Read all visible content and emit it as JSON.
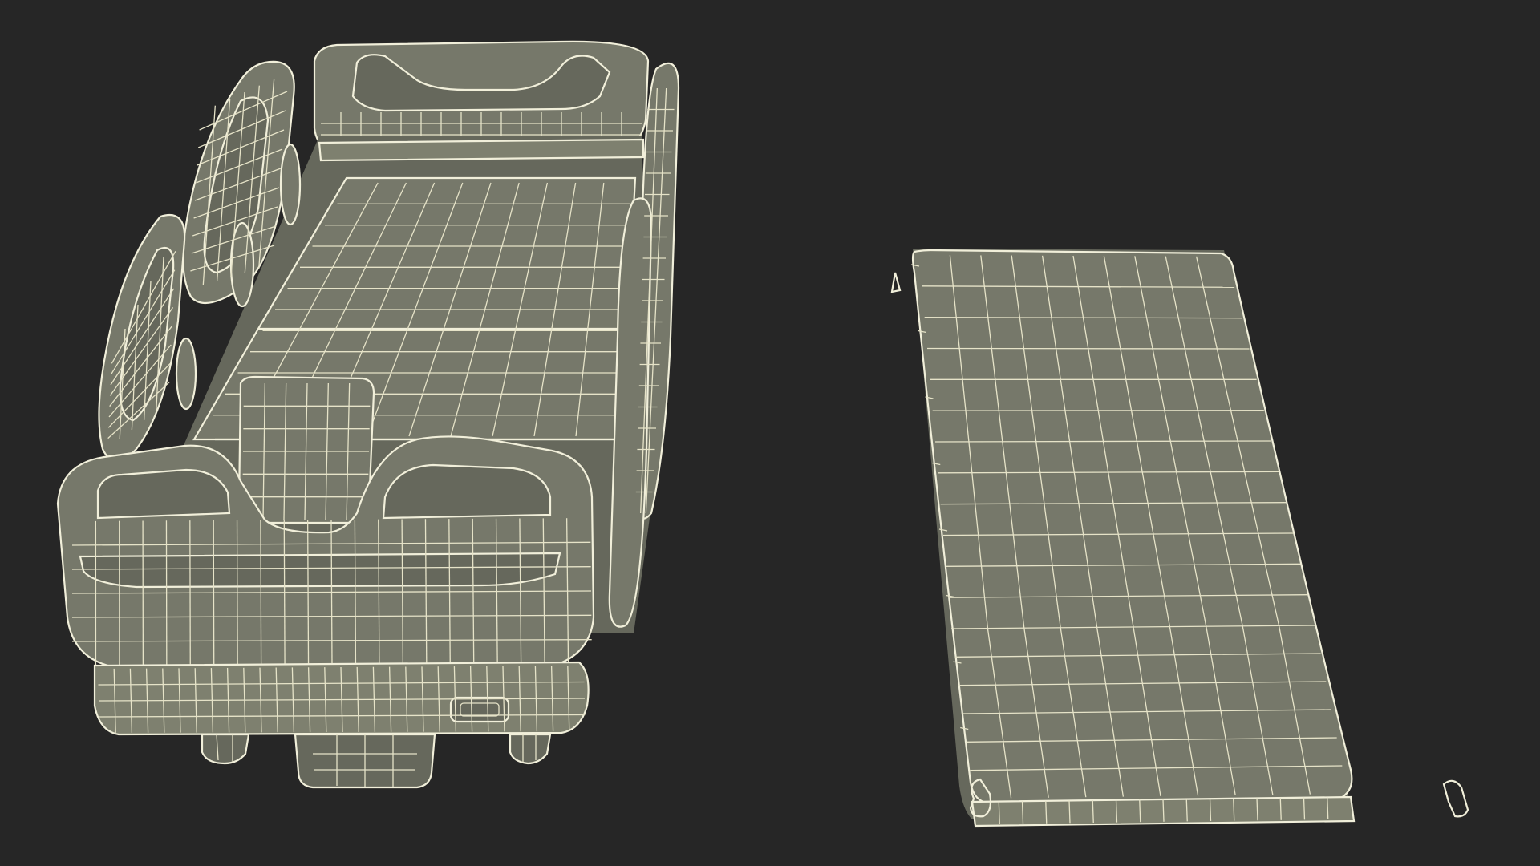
{
  "scene": {
    "background_color": "#262626",
    "mesh_fill_color": "#76786a",
    "wire_color": "#e6e3c8",
    "objects": [
      {
        "name": "hospital-bed-wireframe",
        "label": ""
      },
      {
        "name": "mattress-wireframe",
        "label": ""
      }
    ]
  }
}
